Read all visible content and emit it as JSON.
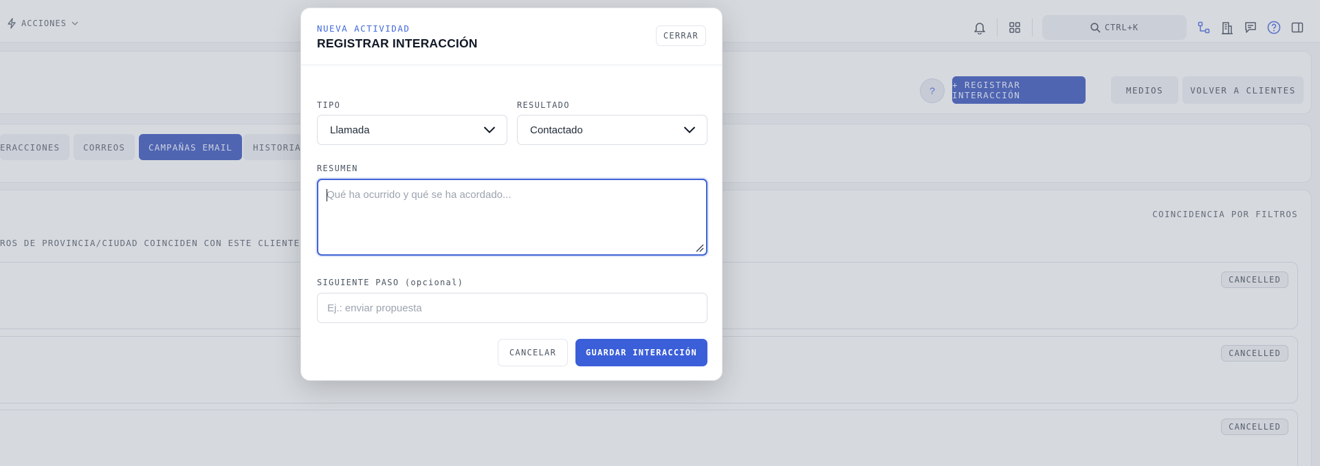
{
  "topbar": {
    "actions_label": "ACCIONES",
    "search_label": "CTRL+K",
    "icons": [
      "bell-icon",
      "grid-icon",
      "search-icon",
      "hierarchy-icon",
      "building-icon",
      "chat-icon",
      "help-circle-icon",
      "panel-icon"
    ]
  },
  "header": {
    "help_label": "?",
    "register_label": "+ REGISTRAR INTERACCIÓN",
    "media_label": "MEDIOS",
    "back_label": "VOLVER A CLIENTES"
  },
  "tabs": [
    {
      "label": "ERACCIONES",
      "active": false
    },
    {
      "label": "CORREOS",
      "active": false
    },
    {
      "label": "CAMPAÑAS EMAIL",
      "active": true
    },
    {
      "label": "HISTORIAL",
      "active": false
    }
  ],
  "list": {
    "match_label": "COINCIDENCIA POR FILTROS",
    "info_text": "ROS DE PROVINCIA/CIUDAD COINCIDEN CON ESTE CLIENTE. NO",
    "rows": [
      {
        "status": "CANCELLED"
      },
      {
        "status": "CANCELLED"
      },
      {
        "status": "CANCELLED"
      }
    ]
  },
  "modal": {
    "kicker": "NUEVA ACTIVIDAD",
    "title": "REGISTRAR INTERACCIÓN",
    "close_label": "CERRAR",
    "type_label": "TIPO",
    "type_value": "Llamada",
    "result_label": "RESULTADO",
    "result_value": "Contactado",
    "summary_label": "RESUMEN",
    "summary_placeholder": "Qué ha ocurrido y qué se ha acordado...",
    "next_label": "SIGUIENTE PASO (opcional)",
    "next_placeholder": "Ej.: enviar propuesta",
    "cancel_label": "CANCELAR",
    "save_label": "GUARDAR INTERACCIÓN"
  },
  "colors": {
    "primary": "#3b5fd9",
    "primary_dark": "#2b49b8",
    "kicker": "#4169d8",
    "focus_border": "#3f63d4"
  }
}
